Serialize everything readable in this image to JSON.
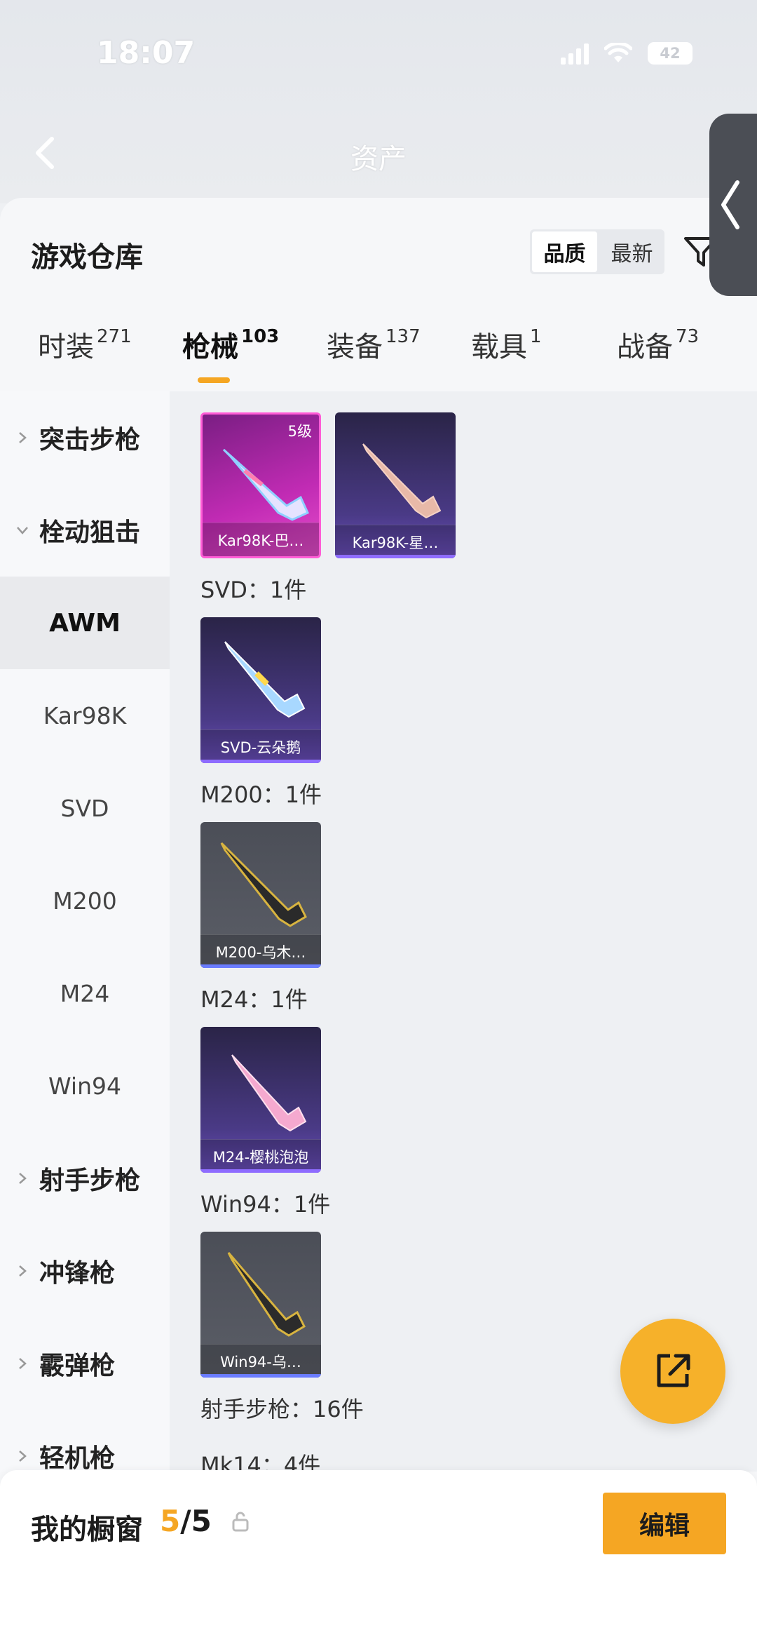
{
  "status_bar": {
    "time": "18:07",
    "battery": "42"
  },
  "nav": {
    "title": "资产"
  },
  "panel": {
    "title": "游戏仓库",
    "sort_options": [
      "品质",
      "最新"
    ],
    "active_sort": "品质"
  },
  "tabs": [
    {
      "label": "时装",
      "count": "271"
    },
    {
      "label": "枪械",
      "count": "103"
    },
    {
      "label": "装备",
      "count": "137"
    },
    {
      "label": "载具",
      "count": "1"
    },
    {
      "label": "战备",
      "count": "73"
    }
  ],
  "active_tab": "枪械",
  "categories": [
    {
      "label": "突击步枪",
      "type": "group",
      "expanded": false
    },
    {
      "label": "栓动狙击",
      "type": "group",
      "expanded": true
    },
    {
      "label": "AWM",
      "type": "sub",
      "active": true
    },
    {
      "label": "Kar98K",
      "type": "sub"
    },
    {
      "label": "SVD",
      "type": "sub"
    },
    {
      "label": "M200",
      "type": "sub"
    },
    {
      "label": "M24",
      "type": "sub"
    },
    {
      "label": "Win94",
      "type": "sub"
    },
    {
      "label": "射手步枪",
      "type": "group",
      "expanded": false
    },
    {
      "label": "冲锋枪",
      "type": "group",
      "expanded": false
    },
    {
      "label": "霰弹枪",
      "type": "group",
      "expanded": false
    },
    {
      "label": "轻机枪",
      "type": "group",
      "expanded": false
    }
  ],
  "groups": [
    {
      "title": "SVD：1件"
    },
    {
      "title": "M200：1件"
    },
    {
      "title": "M24：1件"
    },
    {
      "title": "Win94：1件"
    },
    {
      "title": "射手步枪：16件"
    },
    {
      "title": "Mk14：4件"
    }
  ],
  "items": [
    {
      "name": "Kar98K-巴…",
      "rarity": "pink",
      "level": "5级"
    },
    {
      "name": "Kar98K-星…",
      "rarity": "purple"
    },
    {
      "name": "SVD-云朵鹅",
      "rarity": "purple"
    },
    {
      "name": "M200-乌木…",
      "rarity": "grey"
    },
    {
      "name": "M24-樱桃泡泡",
      "rarity": "purple"
    },
    {
      "name": "Win94-乌…",
      "rarity": "grey"
    }
  ],
  "bottom_bar": {
    "label": "我的橱窗",
    "count_current": "5",
    "count_total": "/5",
    "edit_label": "编辑"
  },
  "colors": {
    "accent": "#f5a623",
    "pink_rarity": "#e54dcb",
    "purple_rarity": "#6b4fbd"
  }
}
